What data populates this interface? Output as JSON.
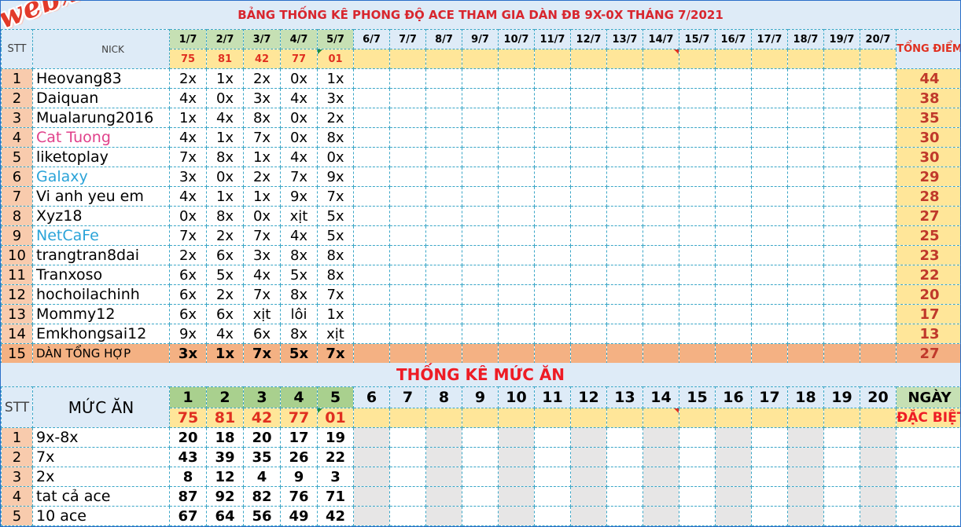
{
  "title": "BẢNG THỐNG KÊ PHONG ĐỘ ACE THAM GIA DÀN ĐB 9X-0X THÁNG 7/2021",
  "logo": "webxoso.net",
  "table1": {
    "stt_header": "STT",
    "nick_header": "NICK",
    "total_header": "TỔNG ĐIỂM",
    "dates": [
      "1/7",
      "2/7",
      "3/7",
      "4/7",
      "5/7",
      "6/7",
      "7/7",
      "8/7",
      "9/7",
      "10/7",
      "11/7",
      "12/7",
      "13/7",
      "14/7",
      "15/7",
      "16/7",
      "17/7",
      "18/7",
      "19/7",
      "20/7"
    ],
    "results": [
      "75",
      "81",
      "42",
      "77",
      "01",
      "",
      "",
      "",
      "",
      "",
      "",
      "",
      "",
      "",
      "",
      "",
      "",
      "",
      "",
      ""
    ],
    "rows": [
      {
        "stt": "1",
        "nick": "Heovang83",
        "color": "#000000",
        "values": [
          "2x",
          "1x",
          "2x",
          "0x",
          "1x"
        ],
        "total": "44"
      },
      {
        "stt": "2",
        "nick": "Daiquan",
        "color": "#000000",
        "values": [
          "4x",
          "0x",
          "3x",
          "4x",
          "3x"
        ],
        "total": "38"
      },
      {
        "stt": "3",
        "nick": "Mualarung2016",
        "color": "#000000",
        "values": [
          "1x",
          "4x",
          "8x",
          "0x",
          "2x"
        ],
        "total": "35"
      },
      {
        "stt": "4",
        "nick": "Cat  Tuong",
        "color": "#e0408a",
        "values": [
          "4x",
          "1x",
          "7x",
          "0x",
          "8x"
        ],
        "total": "30"
      },
      {
        "stt": "5",
        "nick": "liketoplay",
        "color": "#000000",
        "values": [
          "7x",
          "8x",
          "1x",
          "4x",
          "0x"
        ],
        "total": "30"
      },
      {
        "stt": "6",
        "nick": "Galaxy",
        "color": "#2aa3d8",
        "values": [
          "3x",
          "0x",
          "2x",
          "7x",
          "9x"
        ],
        "total": "29"
      },
      {
        "stt": "7",
        "nick": "Vi  anh  yeu  em",
        "color": "#000000",
        "values": [
          "4x",
          "1x",
          "1x",
          "9x",
          "7x"
        ],
        "total": "28"
      },
      {
        "stt": "8",
        "nick": "Xyz18",
        "color": "#000000",
        "values": [
          "0x",
          "8x",
          "0x",
          "xịt",
          "5x"
        ],
        "total": "27"
      },
      {
        "stt": "9",
        "nick": "NetCaFe",
        "color": "#2aa3d8",
        "values": [
          "7x",
          "2x",
          "7x",
          "4x",
          "5x"
        ],
        "total": "25"
      },
      {
        "stt": "10",
        "nick": "trangtran8dai",
        "color": "#000000",
        "values": [
          "2x",
          "6x",
          "3x",
          "8x",
          "8x"
        ],
        "total": "23"
      },
      {
        "stt": "11",
        "nick": "Tranxoso",
        "color": "#000000",
        "values": [
          "6x",
          "5x",
          "4x",
          "5x",
          "8x"
        ],
        "total": "22"
      },
      {
        "stt": "12",
        "nick": "hochoilachinh",
        "color": "#000000",
        "values": [
          "6x",
          "2x",
          "7x",
          "8x",
          "7x"
        ],
        "total": "20"
      },
      {
        "stt": "13",
        "nick": "Mommy12",
        "color": "#000000",
        "values": [
          "6x",
          "6x",
          "xịt",
          "lôi",
          "1x"
        ],
        "total": "17"
      },
      {
        "stt": "14",
        "nick": "Emkhongsai12",
        "color": "#000000",
        "values": [
          "9x",
          "4x",
          "6x",
          "8x",
          "xịt"
        ],
        "total": "13"
      }
    ],
    "summary": {
      "stt": "15",
      "nick": "DÀN TỔNG HỢP",
      "values": [
        "3x",
        "1x",
        "7x",
        "5x",
        "7x"
      ],
      "total": "27"
    }
  },
  "section2_title": "THỐNG KÊ MỨC ĂN",
  "table2": {
    "stt_header": "STT",
    "label_header": "MỨC ĂN",
    "day_numbers": [
      "1",
      "2",
      "3",
      "4",
      "5",
      "6",
      "7",
      "8",
      "9",
      "10",
      "11",
      "12",
      "13",
      "14",
      "15",
      "16",
      "17",
      "18",
      "19",
      "20"
    ],
    "results": [
      "75",
      "81",
      "42",
      "77",
      "01",
      "",
      "",
      "",
      "",
      "",
      "",
      "",
      "",
      "",
      "",
      "",
      "",
      "",
      "",
      ""
    ],
    "ngay_header": "NGÀY",
    "dacbiet_header": "ĐẶC BIỆT",
    "rows": [
      {
        "stt": "1",
        "label": "9x-8x",
        "values": [
          "20",
          "18",
          "20",
          "17",
          "19"
        ]
      },
      {
        "stt": "2",
        "label": "7x",
        "values": [
          "43",
          "39",
          "35",
          "26",
          "22"
        ]
      },
      {
        "stt": "3",
        "label": "2x",
        "values": [
          "8",
          "12",
          "4",
          "9",
          "3"
        ]
      },
      {
        "stt": "4",
        "label": "tat cả ace",
        "values": [
          "87",
          "92",
          "82",
          "76",
          "71"
        ]
      },
      {
        "stt": "5",
        "label": "10 ace",
        "values": [
          "67",
          "64",
          "56",
          "49",
          "42"
        ]
      }
    ]
  }
}
